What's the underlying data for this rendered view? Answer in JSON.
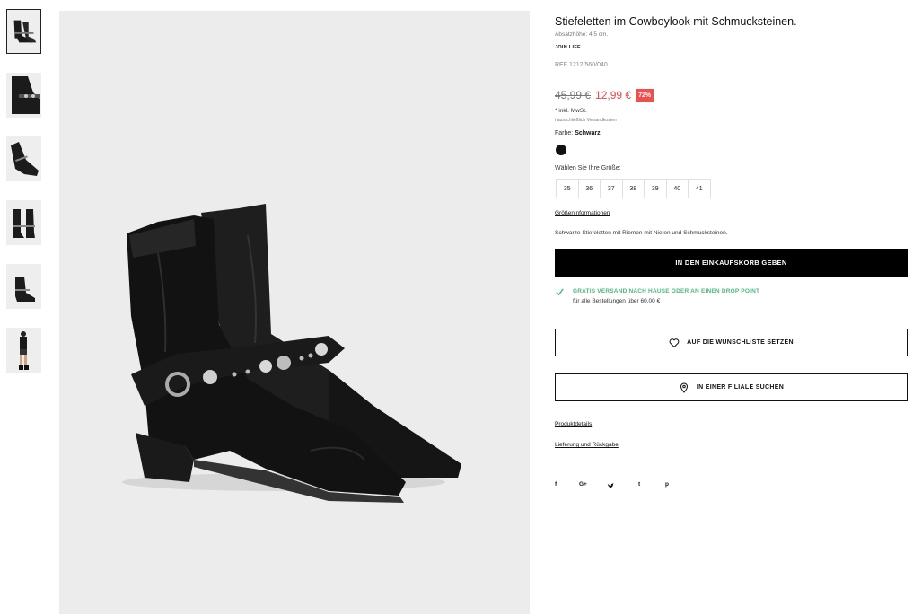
{
  "thumbnails": [
    {
      "label": "boot-pair-thumbnail"
    },
    {
      "label": "boot-strap-detail-thumbnail"
    },
    {
      "label": "boot-side-thumbnail"
    },
    {
      "label": "boot-front-thumbnail"
    },
    {
      "label": "boot-back-thumbnail"
    },
    {
      "label": "model-wearing-thumbnail"
    }
  ],
  "product": {
    "title": "Stiefeletten im Cowboylook mit Schmucksteinen.",
    "heel": "Absatzhöhe: 4,5 cm.",
    "join_life": "JOIN LIFE",
    "ref": "REF 1212/560/040",
    "old_price": "45,99 €",
    "new_price": "12,99 €",
    "discount": "72%",
    "vat": "* inkl. MwSt.",
    "shipping_note": "/ ausschließlich Versandkosten",
    "color_label": "Farbe:",
    "color_value": "Schwarz",
    "swatch_color": "#111111",
    "size_label": "Wählen Sie Ihre Größe:",
    "sizes": [
      "35",
      "36",
      "37",
      "38",
      "39",
      "40",
      "41"
    ],
    "size_info": "Größeninformationen",
    "description": "Schwarze Stiefeletten mit Riemen mit Nieten und Schmucksteinen."
  },
  "actions": {
    "cart": "IN DEN EINKAUFSKORB GEBEN",
    "free_shipping_title": "GRATIS VERSAND NACH HAUSE ODER AN EINEN DROP POINT",
    "free_shipping_sub": "für alle Bestellungen über 60,00 €",
    "wishlist": "AUF DIE WUNSCHLISTE SETZEN",
    "store": "IN EINER FILIALE SUCHEN"
  },
  "links": {
    "details": "Produktdetails",
    "delivery": "Lieferung und Rückgabe"
  },
  "social": {
    "facebook": "f",
    "gplus": "G+",
    "twitter": "t-bird",
    "tumblr": "t",
    "pinterest": "p"
  },
  "colors": {
    "accent_green": "#4db880",
    "sale_red": "#e64a4a",
    "discount_bg": "#ee5050",
    "image_bg": "#ececec"
  }
}
